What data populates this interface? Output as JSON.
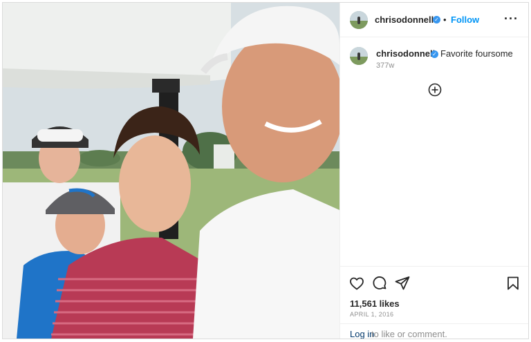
{
  "post": {
    "author": {
      "username": "chrisodonnell",
      "verified": true,
      "avatar_icon": "profile-avatar"
    },
    "header": {
      "separator": "•",
      "follow_label": "Follow",
      "more_icon": "more-horizontal-icon"
    },
    "caption": {
      "username": "chrisodonnell",
      "text": "Favorite foursome",
      "time_ago": "377w"
    },
    "load_more_icon": "plus-circle-icon",
    "actions": {
      "like_icon": "heart-icon",
      "comment_icon": "comment-icon",
      "share_icon": "share-icon",
      "save_icon": "bookmark-icon"
    },
    "likes_text": "11,561 likes",
    "date_text": "APRIL 1, 2016",
    "login": {
      "link_label": "Log in",
      "rest_text": "to like or comment."
    }
  },
  "colors": {
    "link_blue": "#0095f6",
    "verified_blue": "#3897f0",
    "border": "#dbdbdb",
    "muted_text": "#8e8e8e"
  }
}
